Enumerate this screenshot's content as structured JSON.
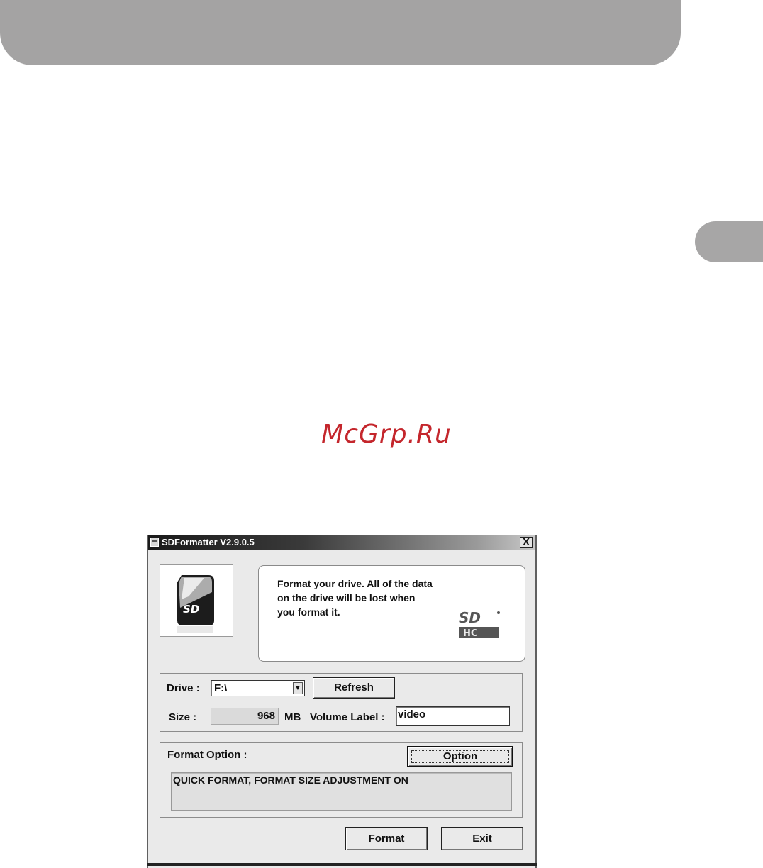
{
  "page": {
    "watermark": "McGrp.Ru"
  },
  "window": {
    "title": "SDFormatter V2.9.0.5",
    "close_label": "X"
  },
  "info": {
    "line1": "Format your drive. All of the data",
    "line2": "on the drive will be lost when",
    "line3": "you format it."
  },
  "drive": {
    "drive_label": "Drive :",
    "selected_drive": "F:\\",
    "refresh_label": "Refresh",
    "size_label": "Size :",
    "size_value": "968",
    "size_unit": "MB",
    "volume_label_label": "Volume Label :",
    "volume_label_value": "video"
  },
  "format_option": {
    "label": "Format Option :",
    "option_button": "Option",
    "description": "QUICK FORMAT, FORMAT SIZE ADJUSTMENT ON"
  },
  "actions": {
    "format_label": "Format",
    "exit_label": "Exit"
  },
  "icons": {
    "app": "sdformatter-app-icon",
    "sd_card": "sd-card-logo",
    "sdhc": "sdhc-logo",
    "dropdown": "chevron-down-icon",
    "close": "close-icon"
  },
  "colors": {
    "header_bar": "#a4a3a3",
    "watermark": "#c4262c",
    "window_bg": "#eaeaea"
  }
}
